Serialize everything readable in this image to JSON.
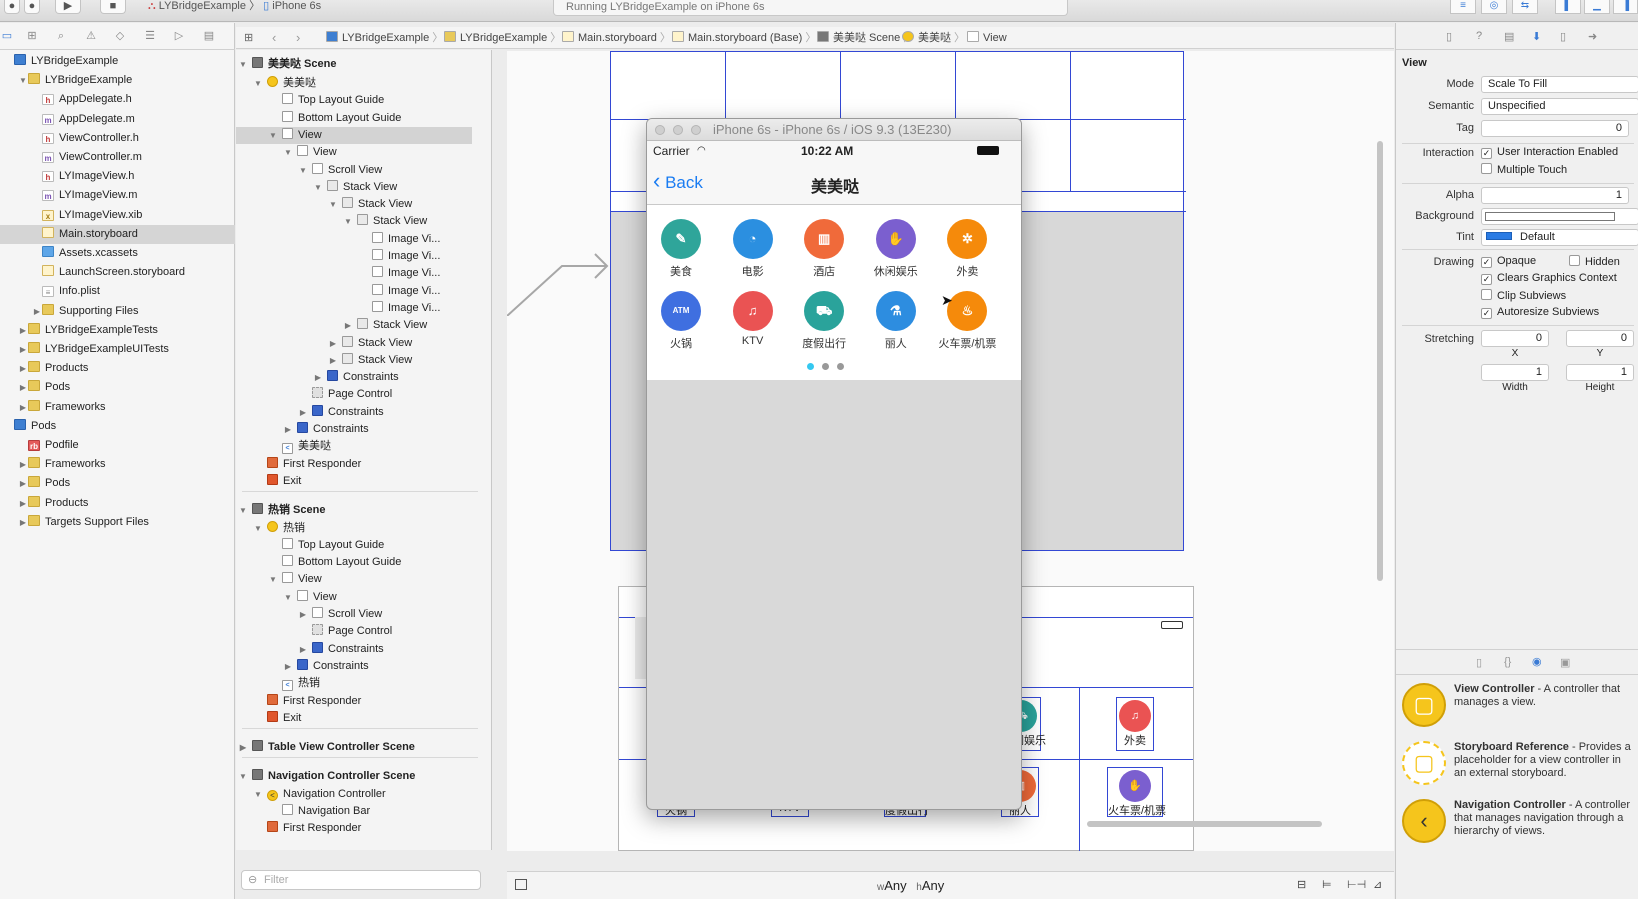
{
  "toolbar": {
    "scheme": "LYBridgeExample",
    "device": "iPhone 6s",
    "status": "Running LYBridgeExample on iPhone 6s"
  },
  "navigator": {
    "items": [
      {
        "label": "LYBridgeExample",
        "icon": "project-icon",
        "indent": 0,
        "disc": ""
      },
      {
        "label": "LYBridgeExample",
        "icon": "folder-icon",
        "indent": 1,
        "disc": "▼"
      },
      {
        "label": "AppDelegate.h",
        "icon": "header-file-icon",
        "indent": 2,
        "disc": ""
      },
      {
        "label": "AppDelegate.m",
        "icon": "source-file-icon",
        "indent": 2,
        "disc": ""
      },
      {
        "label": "ViewController.h",
        "icon": "header-file-icon",
        "indent": 2,
        "disc": ""
      },
      {
        "label": "ViewController.m",
        "icon": "source-file-icon",
        "indent": 2,
        "disc": ""
      },
      {
        "label": "LYImageView.h",
        "icon": "header-file-icon",
        "indent": 2,
        "disc": ""
      },
      {
        "label": "LYImageView.m",
        "icon": "source-file-icon",
        "indent": 2,
        "disc": ""
      },
      {
        "label": "LYImageView.xib",
        "icon": "xib-file-icon",
        "indent": 2,
        "disc": ""
      },
      {
        "label": "Main.storyboard",
        "icon": "storyboard-file-icon",
        "indent": 2,
        "disc": "",
        "selected": true
      },
      {
        "label": "Assets.xcassets",
        "icon": "assets-icon",
        "indent": 2,
        "disc": ""
      },
      {
        "label": "LaunchScreen.storyboard",
        "icon": "storyboard-file-icon",
        "indent": 2,
        "disc": ""
      },
      {
        "label": "Info.plist",
        "icon": "plist-icon",
        "indent": 2,
        "disc": ""
      },
      {
        "label": "Supporting Files",
        "icon": "folder-icon",
        "indent": 2,
        "disc": "▶"
      },
      {
        "label": "LYBridgeExampleTests",
        "icon": "folder-icon",
        "indent": 1,
        "disc": "▶"
      },
      {
        "label": "LYBridgeExampleUITests",
        "icon": "folder-icon",
        "indent": 1,
        "disc": "▶"
      },
      {
        "label": "Products",
        "icon": "folder-icon",
        "indent": 1,
        "disc": "▶"
      },
      {
        "label": "Pods",
        "icon": "folder-icon",
        "indent": 1,
        "disc": "▶"
      },
      {
        "label": "Frameworks",
        "icon": "folder-icon",
        "indent": 1,
        "disc": "▶"
      },
      {
        "label": "Pods",
        "icon": "project-icon",
        "indent": 0,
        "disc": ""
      },
      {
        "label": "Podfile",
        "icon": "podfile-icon",
        "indent": 1,
        "disc": ""
      },
      {
        "label": "Frameworks",
        "icon": "folder-icon",
        "indent": 1,
        "disc": "▶"
      },
      {
        "label": "Pods",
        "icon": "folder-icon",
        "indent": 1,
        "disc": "▶"
      },
      {
        "label": "Products",
        "icon": "folder-icon",
        "indent": 1,
        "disc": "▶"
      },
      {
        "label": "Targets Support Files",
        "icon": "folder-icon",
        "indent": 1,
        "disc": "▶"
      }
    ],
    "filter_placeholder": "Filter"
  },
  "jumpbar": [
    "LYBridgeExample",
    "LYBridgeExample",
    "Main.storyboard",
    "Main.storyboard (Base)",
    "美美哒 Scene",
    "美美哒",
    "View"
  ],
  "outline": [
    {
      "label": "美美哒 Scene",
      "icon": "scene",
      "x": 0,
      "bold": true,
      "disc": "▼"
    },
    {
      "label": "美美哒",
      "icon": "vc",
      "x": 1,
      "disc": "▼"
    },
    {
      "label": "Top Layout Guide",
      "icon": "view",
      "x": 2,
      "disc": ""
    },
    {
      "label": "Bottom Layout Guide",
      "icon": "view",
      "x": 2,
      "disc": ""
    },
    {
      "label": "View",
      "icon": "view",
      "x": 2,
      "disc": "▼",
      "selected": true
    },
    {
      "label": "View",
      "icon": "view",
      "x": 3,
      "disc": "▼"
    },
    {
      "label": "Scroll View",
      "icon": "view",
      "x": 4,
      "disc": "▼"
    },
    {
      "label": "Stack View",
      "icon": "stack",
      "x": 5,
      "disc": "▼"
    },
    {
      "label": "Stack View",
      "icon": "stack",
      "x": 6,
      "disc": "▼"
    },
    {
      "label": "Stack View",
      "icon": "stack",
      "x": 7,
      "disc": "▼"
    },
    {
      "label": "Image Vi...",
      "icon": "view",
      "x": 8,
      "disc": ""
    },
    {
      "label": "Image Vi...",
      "icon": "view",
      "x": 8,
      "disc": ""
    },
    {
      "label": "Image Vi...",
      "icon": "view",
      "x": 8,
      "disc": ""
    },
    {
      "label": "Image Vi...",
      "icon": "view",
      "x": 8,
      "disc": ""
    },
    {
      "label": "Image Vi...",
      "icon": "view",
      "x": 8,
      "disc": ""
    },
    {
      "label": "Stack View",
      "icon": "stack",
      "x": 7,
      "disc": "▶"
    },
    {
      "label": "Stack View",
      "icon": "stack",
      "x": 6,
      "disc": "▶"
    },
    {
      "label": "Stack View",
      "icon": "stack",
      "x": 6,
      "disc": "▶"
    },
    {
      "label": "Constraints",
      "icon": "cons",
      "x": 5,
      "disc": "▶"
    },
    {
      "label": "Page Control",
      "icon": "pc",
      "x": 4,
      "disc": ""
    },
    {
      "label": "Constraints",
      "icon": "cons",
      "x": 4,
      "disc": "▶"
    },
    {
      "label": "Constraints",
      "icon": "cons",
      "x": 3,
      "disc": "▶"
    },
    {
      "label": "美美哒",
      "icon": "back",
      "x": 2,
      "disc": ""
    },
    {
      "label": "First Responder",
      "icon": "resp",
      "x": 1,
      "disc": ""
    },
    {
      "label": "Exit",
      "icon": "exit",
      "x": 1,
      "disc": ""
    },
    {
      "label": "热销 Scene",
      "icon": "scene",
      "x": 0,
      "bold": true,
      "disc": "▼",
      "sep": true
    },
    {
      "label": "热销",
      "icon": "vc",
      "x": 1,
      "disc": "▼"
    },
    {
      "label": "Top Layout Guide",
      "icon": "view",
      "x": 2,
      "disc": ""
    },
    {
      "label": "Bottom Layout Guide",
      "icon": "view",
      "x": 2,
      "disc": ""
    },
    {
      "label": "View",
      "icon": "view",
      "x": 2,
      "disc": "▼"
    },
    {
      "label": "View",
      "icon": "view",
      "x": 3,
      "disc": "▼"
    },
    {
      "label": "Scroll View",
      "icon": "view",
      "x": 4,
      "disc": "▶"
    },
    {
      "label": "Page Control",
      "icon": "pc",
      "x": 4,
      "disc": ""
    },
    {
      "label": "Constraints",
      "icon": "cons",
      "x": 4,
      "disc": "▶"
    },
    {
      "label": "Constraints",
      "icon": "cons",
      "x": 3,
      "disc": "▶"
    },
    {
      "label": "热销",
      "icon": "back",
      "x": 2,
      "disc": ""
    },
    {
      "label": "First Responder",
      "icon": "resp",
      "x": 1,
      "disc": ""
    },
    {
      "label": "Exit",
      "icon": "exit",
      "x": 1,
      "disc": ""
    },
    {
      "label": "Table View Controller Scene",
      "icon": "scene",
      "x": 0,
      "bold": true,
      "disc": "▶",
      "sep": true
    },
    {
      "label": "Navigation Controller Scene",
      "icon": "scene",
      "x": 0,
      "bold": true,
      "disc": "▼",
      "sep": true
    },
    {
      "label": "Navigation Controller",
      "icon": "nav",
      "x": 1,
      "disc": "▼"
    },
    {
      "label": "Navigation Bar",
      "icon": "view",
      "x": 2,
      "disc": ""
    },
    {
      "label": "First Responder",
      "icon": "resp",
      "x": 1,
      "disc": ""
    }
  ],
  "simulator": {
    "title": "iPhone 6s - iPhone 6s / iOS 9.3 (13E230)",
    "carrier": "Carrier",
    "time": "10:22 AM",
    "back": "Back",
    "nav_title": "美美哒",
    "categories": [
      {
        "label": "美食",
        "color": "#2fa59a",
        "glyph": "✎"
      },
      {
        "label": "电影",
        "color": "#2b8fe0",
        "glyph": "◔"
      },
      {
        "label": "酒店",
        "color": "#f06a3a",
        "glyph": "▥"
      },
      {
        "label": "休闲娱乐",
        "color": "#7b5fcf",
        "glyph": "✋"
      },
      {
        "label": "外卖",
        "color": "#f58a0b",
        "glyph": "✲"
      },
      {
        "label": "火锅",
        "color": "#3f6fe0",
        "glyph": "ATM"
      },
      {
        "label": "KTV",
        "color": "#ea5353",
        "glyph": "♫"
      },
      {
        "label": "度假出行",
        "color": "#2aa39b",
        "glyph": "⛟"
      },
      {
        "label": "丽人",
        "color": "#2d8de0",
        "glyph": "⚗"
      },
      {
        "label": "火车票/机票",
        "color": "#f58a0b",
        "glyph": "♨"
      }
    ],
    "page_dots": 3,
    "current_page": 1
  },
  "lower_scene": {
    "labels": [
      "休闲娱乐",
      "外卖",
      "火锅",
      "KTV",
      "度假出行",
      "丽人",
      "火车票/机票"
    ]
  },
  "inspector": {
    "section": "View",
    "mode_label": "Mode",
    "mode": "Scale To Fill",
    "semantic_label": "Semantic",
    "semantic": "Unspecified",
    "tag_label": "Tag",
    "tag": "0",
    "interaction_label": "Interaction",
    "user_interaction": "User Interaction Enabled",
    "multiple_touch": "Multiple Touch",
    "alpha_label": "Alpha",
    "alpha": "1",
    "background_label": "Background",
    "tint_label": "Tint",
    "tint": "Default",
    "drawing_label": "Drawing",
    "opaque": "Opaque",
    "hidden": "Hidden",
    "clears": "Clears Graphics Context",
    "clip": "Clip Subviews",
    "autoresize": "Autoresize Subviews",
    "stretching_label": "Stretching",
    "x_val": "0",
    "y_val": "0",
    "w_val": "1",
    "h_val": "1",
    "x_label": "X",
    "y_label": "Y",
    "width_label": "Width",
    "height_label": "Height",
    "tint_color": "#2a7be4"
  },
  "library": [
    {
      "title": "View Controller",
      "desc": " - A controller that manages a view."
    },
    {
      "title": "Storyboard Reference",
      "desc": " - Provides a placeholder for a view controller in an external storyboard."
    },
    {
      "title": "Navigation Controller",
      "desc": " - A controller that manages navigation through a hierarchy of views."
    }
  ],
  "bottombar": {
    "w_prefix": "w",
    "w_any": "Any",
    "h_prefix": "h",
    "h_any": "Any"
  }
}
